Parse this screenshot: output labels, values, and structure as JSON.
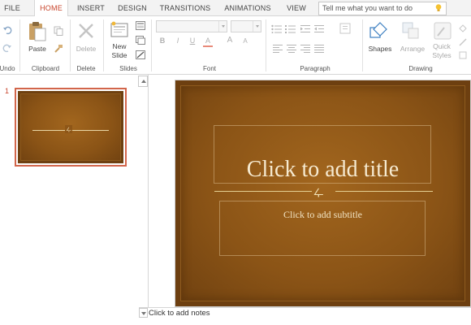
{
  "tabs": [
    {
      "label": "FILE",
      "active": false
    },
    {
      "label": "HOME",
      "active": true
    },
    {
      "label": "INSERT",
      "active": false
    },
    {
      "label": "DESIGN",
      "active": false
    },
    {
      "label": "TRANSITIONS",
      "active": false
    },
    {
      "label": "ANIMATIONS",
      "active": false
    },
    {
      "label": "VIEW",
      "active": false
    }
  ],
  "search": {
    "placeholder": "Tell me what you want to do"
  },
  "ribbon": {
    "groups": {
      "undo": "Undo",
      "clipboard": "Clipboard",
      "delete": "Delete",
      "slides": "Slides",
      "font": "Font",
      "paragraph": "Paragraph",
      "drawing": "Drawing"
    },
    "buttons": {
      "paste": "Paste",
      "delete": "Delete",
      "new_slide_line1": "New",
      "new_slide_line2": "Slide",
      "shapes": "Shapes",
      "arrange": "Arrange",
      "quick_styles_line1": "Quick",
      "quick_styles_line2": "Styles"
    },
    "font_buttons": {
      "bold": "B",
      "italic": "I",
      "underline": "U",
      "font_color": "A",
      "grow": "A",
      "shrink": "A"
    }
  },
  "thumbnails": [
    {
      "number": "1"
    }
  ],
  "slide": {
    "title_placeholder": "Click to add title",
    "subtitle_placeholder": "Click to add subtitle",
    "ornament": "ഺ"
  },
  "notes": {
    "placeholder": "Click to add notes"
  },
  "colors": {
    "accent": "#c8452c",
    "slide_brown": "#8b5416",
    "slide_text": "#f6ead0"
  },
  "icons": [
    "undo-icon",
    "redo-icon",
    "paste-icon",
    "copy-icon",
    "format-painter-icon",
    "delete-icon",
    "new-slide-icon",
    "layout-icon",
    "reset-icon",
    "section-icon",
    "bullets-icon",
    "numbering-icon",
    "indent-icon",
    "align-icon",
    "shapes-icon",
    "arrange-icon",
    "quick-styles-icon",
    "lightbulb-icon"
  ]
}
